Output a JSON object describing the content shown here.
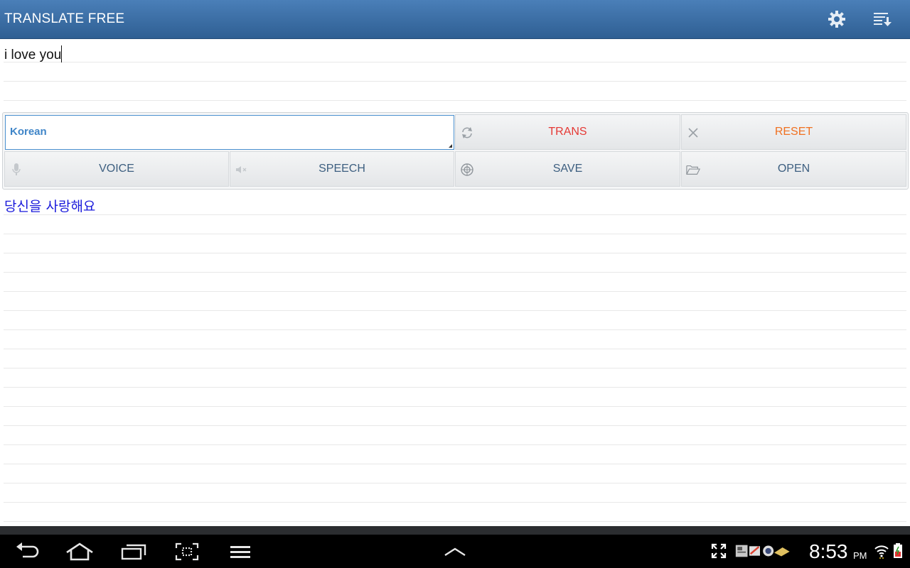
{
  "app": {
    "title": "TRANSLATE FREE"
  },
  "action_bar": {
    "icons": [
      "gear-icon",
      "sort-download-icon"
    ]
  },
  "input": {
    "text": "i love you"
  },
  "controls": {
    "language": "Korean",
    "buttons": {
      "trans": "TRANS",
      "reset": "RESET",
      "voice": "VOICE",
      "speech": "SPEECH",
      "save": "SAVE",
      "open": "OPEN"
    },
    "colors": {
      "trans": "#e53935",
      "reset": "#f07020",
      "default": "#3d5f80",
      "language": "#3f85c8"
    }
  },
  "output": {
    "text": "당신을 사랑해요",
    "color": "#1a1adb"
  },
  "status_bar": {
    "time": "8:53",
    "ampm": "PM",
    "icons": [
      "back-icon",
      "home-icon",
      "recent-apps-icon",
      "screenshot-icon",
      "menu-icon",
      "up-chevron-icon",
      "fullscreen-icon",
      "notification-icons",
      "wifi-icon",
      "battery-icon"
    ]
  }
}
